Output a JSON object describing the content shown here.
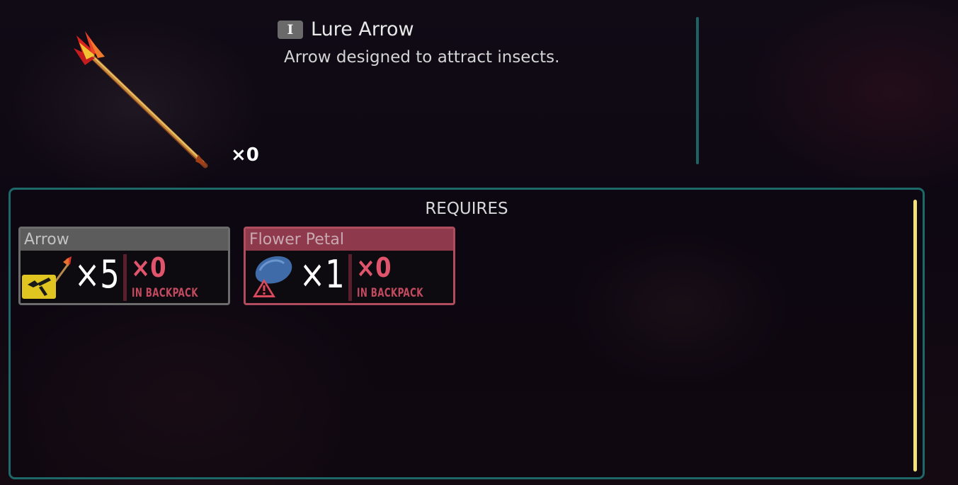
{
  "item": {
    "key_hint": "I",
    "name": "Lure Arrow",
    "description": "Arrow designed to attract insects.",
    "count": "×0"
  },
  "requires": {
    "title": "REQUIRES",
    "cards": [
      {
        "name": "Arrow",
        "required": "×5",
        "have": "×0",
        "have_label": "IN BACKPACK",
        "badge_icon": "crafting-hammer-icon",
        "status": "ok"
      },
      {
        "name": "Flower Petal",
        "required": "×1",
        "have": "×0",
        "have_label": "IN BACKPACK",
        "badge_icon": "warning-triangle-icon",
        "status": "missing"
      }
    ]
  },
  "colors": {
    "panel_border": "#1d6868",
    "missing_accent": "#e0556b",
    "scrollbar": "#f2e07a"
  }
}
